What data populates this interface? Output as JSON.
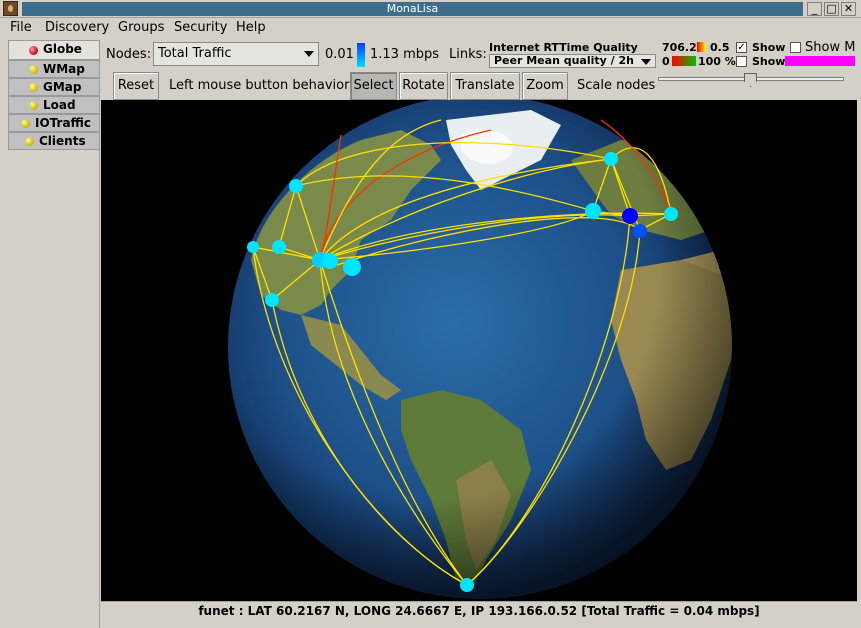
{
  "window": {
    "title": "MonaLisa",
    "minimize": "_",
    "maximize": "□",
    "close": "✕"
  },
  "menu": [
    "File",
    "Discovery",
    "Groups",
    "Security",
    "Help"
  ],
  "sidebar": {
    "tabs": [
      {
        "label": "Globe",
        "active": true
      },
      {
        "label": "WMap"
      },
      {
        "label": "GMap"
      },
      {
        "label": "Load"
      },
      {
        "label": "IOTraffic"
      },
      {
        "label": "Clients"
      }
    ]
  },
  "nodes": {
    "label": "Nodes:",
    "selected": "Total Traffic",
    "range_min": "0.01",
    "range_max": "1.13 mbps"
  },
  "links": {
    "label": "Links:",
    "title": "Internet RTTime Quality",
    "selected": "Peer Mean quality / 2h",
    "rt_max": "706.2",
    "rt_min": "0.5",
    "q_min": "0",
    "q_max": "100 %",
    "show1": "Show",
    "show2": "Show",
    "show_m": "Show M",
    "show1_checked": true,
    "show2_checked": false
  },
  "toolbar": {
    "reset": "Reset",
    "behavior_label": "Left mouse button behavior:",
    "select": "Select",
    "rotate": "Rotate",
    "translate": "Translate",
    "zoom": "Zoom",
    "scale_label": "Scale nodes",
    "scale_value": 0.5
  },
  "status": {
    "text": "funet : LAT 60.2167 N, LONG 24.6667 E, IP 193.166.0.52  [Total Traffic = 0.04 mbps]"
  },
  "colors": {
    "titlebar": "#3e6e8e",
    "node": "#00e5ff",
    "node_selected": "#0000ff",
    "link": "#ffe000",
    "link_red": "#ff3000",
    "magenta": "#ff00ff"
  }
}
